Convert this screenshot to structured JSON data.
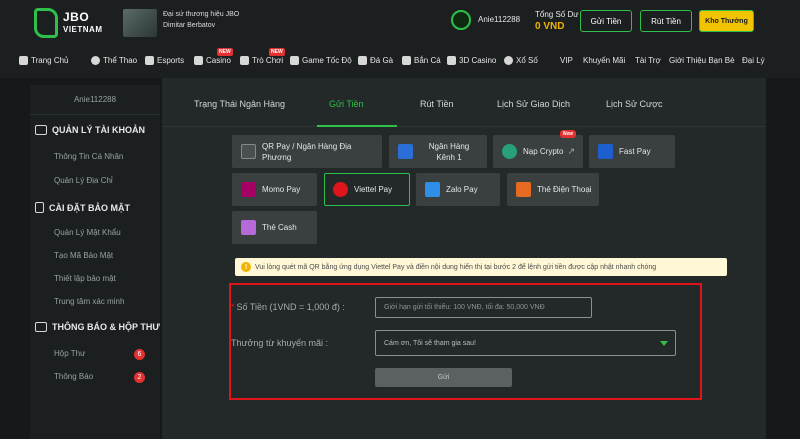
{
  "brand": {
    "line1": "JBO",
    "line2": "VIETNAM"
  },
  "ambassador": {
    "line1": "Đại sứ thương hiệu JBO",
    "line2": "Dimitar Berbatov"
  },
  "account": {
    "username": "Anie112288",
    "balance_label": "Tổng Số Dư",
    "balance_value": "0 VND"
  },
  "header_buttons": {
    "deposit": "Gửi Tiền",
    "withdraw": "Rút Tiền",
    "rewards": "Kho Thưởng"
  },
  "nav": {
    "items": [
      "Trang Chủ",
      "Thể Thao",
      "Esports",
      "Casino",
      "Trò Chơi",
      "Game Tốc Độ",
      "Đá Gà",
      "Bắn Cá",
      "3D Casino",
      "Xổ Số",
      "VIP",
      "Khuyến Mãi",
      "Tài Trợ",
      "Giới Thiệu Bạn Bè",
      "Đại Lý"
    ],
    "new_badge": "NEW"
  },
  "sidebar": {
    "username": "Anie112288",
    "sections": [
      {
        "title": "QUẢN LÝ TÀI KHOẢN",
        "items": [
          "Thông Tin Cá Nhân",
          "Quản Lý Địa Chỉ"
        ]
      },
      {
        "title": "CÀI ĐẶT BẢO MẬT",
        "items": [
          "Quản Lý Mật Khẩu",
          "Tạo Mã Bảo Mật",
          "Thiết lập bảo mật",
          "Trung tâm xác minh"
        ]
      },
      {
        "title": "THÔNG BÁO & HỘP THƯ",
        "items": [
          "Hộp Thư",
          "Thông Báo"
        ],
        "counts": [
          "6",
          "2"
        ]
      }
    ]
  },
  "tabs": [
    "Trạng Thái Ngân Hàng",
    "Gửi Tiền",
    "Rút Tiền",
    "Lịch Sử Giao Dịch",
    "Lịch Sử Cược"
  ],
  "active_tab": "Gửi Tiền",
  "payment_methods": [
    {
      "label": "QR Pay / Ngân Hàng Địa Phương",
      "icon": "qr-code-icon",
      "color": "#4a5050"
    },
    {
      "label": "Ngân Hàng Kênh 1",
      "icon": "bank-icon",
      "color": "#2b6fd6"
    },
    {
      "label": "Nạp Crypto",
      "icon": "tether-icon",
      "color": "#26a17b",
      "badge": "New"
    },
    {
      "label": "Fast Pay",
      "icon": "fastpay-icon",
      "color": "#1e5fd0"
    },
    {
      "label": "Momo Pay",
      "icon": "momo-icon",
      "color": "#a50064"
    },
    {
      "label": "Viettel Pay",
      "icon": "viettelpay-icon",
      "color": "#e0151b"
    },
    {
      "label": "Zalo Pay",
      "icon": "zalopay-icon",
      "color": "#2e8ee8"
    },
    {
      "label": "Thẻ Điện Thoại",
      "icon": "phone-card-icon",
      "color": "#e66a1f"
    },
    {
      "label": "Thẻ Cash",
      "icon": "cash-card-icon",
      "color": "#b56ad8"
    }
  ],
  "active_method": "Viettel Pay",
  "notice": {
    "icon": "!",
    "text": "Vui lòng quét mã QR bằng ứng dụng Viettel Pay và điền nội dung hiển thị tại bước 2 để lệnh gửi tiền được cập nhật nhanh chóng"
  },
  "form": {
    "amount_label": "Số Tiền (1VND = 1,000 đ)  :",
    "amount_required_mark": "*",
    "amount_placeholder": "Giới hạn gửi tối thiểu: 100 VNĐ, tối đa: 50,000 VNĐ",
    "promo_label": "Thưởng từ khuyến mãi  :",
    "promo_selected": "Cám ơn, Tôi sẽ tham gia sau!",
    "submit_label": "Gửi"
  },
  "colors": {
    "accent": "#2fbf4a",
    "highlight": "#e0151b",
    "balance": "#f0b400",
    "badge": "#e23131"
  }
}
